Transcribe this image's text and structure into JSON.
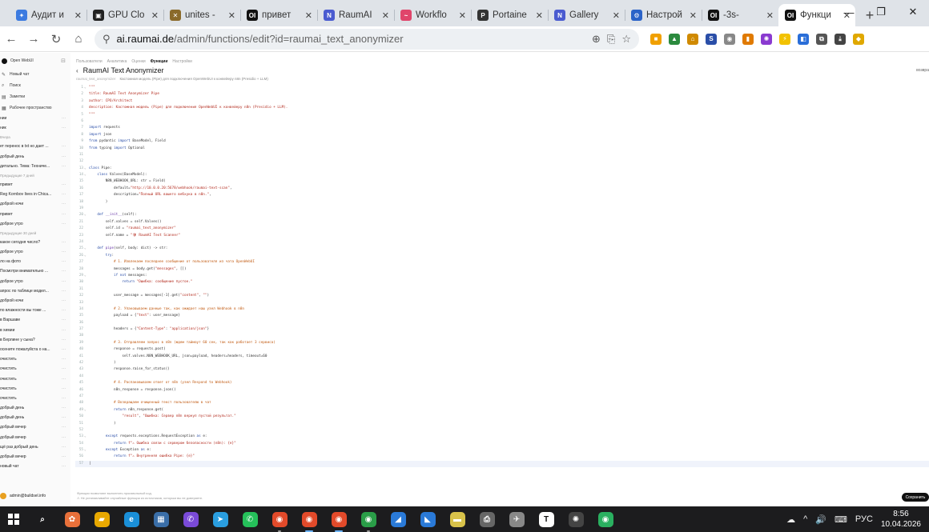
{
  "browser": {
    "tabs": [
      {
        "label": "Аудит и",
        "fav": "✦",
        "fav_color": "#3c7be0",
        "active": false
      },
      {
        "label": "GPU Clo",
        "fav": "▣",
        "fav_color": "#222222",
        "active": false
      },
      {
        "label": "unites -",
        "fav": "✕",
        "fav_color": "#8a6a2a",
        "active": false
      },
      {
        "label": "привет",
        "fav": "OI",
        "fav_color": "#111111",
        "active": false
      },
      {
        "label": "RaumAI",
        "fav": "N",
        "fav_color": "#4a5bd0",
        "active": false
      },
      {
        "label": "Workflo",
        "fav": "~",
        "fav_color": "#e0456b",
        "active": false
      },
      {
        "label": "Portaine",
        "fav": "P",
        "fav_color": "#333333",
        "active": false
      },
      {
        "label": "Gallery",
        "fav": "N",
        "fav_color": "#4a5bd0",
        "active": false
      },
      {
        "label": "Настрой",
        "fav": "⚙",
        "fav_color": "#2b63c8",
        "active": false
      },
      {
        "label": "-3s-",
        "fav": "OI",
        "fav_color": "#111111",
        "active": false
      },
      {
        "label": "Функци",
        "fav": "OI",
        "fav_color": "#111111",
        "active": true
      }
    ],
    "new_tab": "+",
    "window_controls": [
      "—",
      "❐",
      "✕"
    ],
    "url_host": "ai.raumai.de",
    "url_path": "/admin/functions/edit?id=raumai_text_anonymizer",
    "nav": {
      "back": "←",
      "forward": "→",
      "reload": "↻",
      "home": "⌂",
      "site_info": "⚲"
    },
    "omnibox_icons": [
      "⊕",
      "⎘",
      "☆"
    ],
    "extensions": [
      {
        "glyph": "■",
        "color": "#f0a000"
      },
      {
        "glyph": "▲",
        "color": "#2b8a3e"
      },
      {
        "glyph": "⌂",
        "color": "#d08a00"
      },
      {
        "glyph": "S",
        "color": "#2a4ea8"
      },
      {
        "glyph": "◉",
        "color": "#888888"
      },
      {
        "glyph": "▮",
        "color": "#e07a00"
      },
      {
        "glyph": "✺",
        "color": "#8a3ad0"
      },
      {
        "glyph": "⚡",
        "color": "#f2c200"
      },
      {
        "glyph": "◧",
        "color": "#2a6ed8"
      },
      {
        "glyph": "⧉",
        "color": "#555555"
      },
      {
        "glyph": "⤓",
        "color": "#444444"
      },
      {
        "glyph": "◆",
        "color": "#e0a800"
      }
    ]
  },
  "sidebar": {
    "app_name": "Open WebUI",
    "toggle": "⊟",
    "nav": [
      {
        "icon": "✎",
        "label": "Новый чат"
      },
      {
        "icon": "⌕",
        "label": "Поиск"
      },
      {
        "icon": "▤",
        "label": "Заметки"
      },
      {
        "icon": "▦",
        "label": "Рабочее пространство"
      }
    ],
    "sections": [
      {
        "group": "",
        "chats": [
          "нии",
          "ник"
        ]
      },
      {
        "group": "Вчера",
        "chats": [
          "ет перенос в txt но дает ...",
          "добрый день",
          "дитально. Тема: Техниче..."
        ]
      },
      {
        "group": "Предыдущие 7 дней",
        "chats": [
          "привет",
          "Reg Kornbov lives in Chica...",
          "доброй ночи",
          "привет",
          "доброе утро"
        ]
      },
      {
        "group": "Предыдущие 30 дней",
        "chats": [
          "какое сегодня число?",
          "доброе утро",
          "ло на фото",
          "Посмотри внимательно ...",
          "доброе утро",
          "апрос по таблице модел...",
          "доброй ночи",
          "по влажности вы тоже ...",
          "в Варшаве",
          "в химии",
          "в Берлине у сына?",
          "осените пожалуйста о на...",
          "очистить",
          "очистить",
          "очистить",
          "очистить"
        ]
      },
      {
        "group": "",
        "chats": [
          "очистить",
          "добрый день",
          "добрый день",
          "добрый вечер",
          "добрый вечер",
          "щё раз добрый день",
          "добрый вечер",
          "новый чат"
        ]
      }
    ],
    "user": "admin@buildsel.info"
  },
  "page": {
    "breadcrumbs": [
      "Пользователи",
      "Аналитика",
      "Оценки",
      "Функции",
      "Настройки"
    ],
    "active_breadcrumb": 3,
    "back": "‹",
    "title": "RaumAI Text Anonymizer",
    "function_id": "raumai_text_anonymizer",
    "description": "Кастомная модель (Pipe) для подключения OpenWebUI к конвейеру n8n (Presidio + LLM)",
    "right_edge": "возвра",
    "footnote_1": "Функции позволяют выполнять произвольный код.",
    "footnote_2": "⚠ Не устанавливайте случайные функции из источников, которым вы не доверяете.",
    "save_label": "Сохранить"
  },
  "editor": {
    "current_line": 57,
    "lines": [
      {
        "n": "1",
        "f": "⌄",
        "p": [
          [
            "doc",
            "\"\"\""
          ]
        ]
      },
      {
        "n": "2",
        "p": [
          [
            "doc",
            "title: RaumAI Text Anonymizer Pipe"
          ]
        ]
      },
      {
        "n": "3",
        "p": [
          [
            "doc",
            "author: CPO/Architect"
          ]
        ]
      },
      {
        "n": "4",
        "p": [
          [
            "doc",
            "description: Кастомная модель (Pipe) для подключения OpenWebUI к конвейеру n8n (Presidio + LLM)."
          ]
        ]
      },
      {
        "n": "5",
        "p": [
          [
            "doc",
            "\"\"\""
          ]
        ]
      },
      {
        "n": "6",
        "p": []
      },
      {
        "n": "7",
        "p": [
          [
            "kw",
            "import"
          ],
          [
            "t",
            " requests"
          ]
        ]
      },
      {
        "n": "8",
        "p": [
          [
            "kw",
            "import"
          ],
          [
            "t",
            " json"
          ]
        ]
      },
      {
        "n": "9",
        "p": [
          [
            "kw",
            "from"
          ],
          [
            "t",
            " pydantic "
          ],
          [
            "kw",
            "import"
          ],
          [
            "t",
            " BaseModel, Field"
          ]
        ]
      },
      {
        "n": "10",
        "p": [
          [
            "kw",
            "from"
          ],
          [
            "t",
            " typing "
          ],
          [
            "kw",
            "import"
          ],
          [
            "t",
            " Optional"
          ]
        ]
      },
      {
        "n": "11",
        "p": []
      },
      {
        "n": "12",
        "p": []
      },
      {
        "n": "13",
        "f": "⌄",
        "p": [
          [
            "kw",
            "class"
          ],
          [
            "t",
            " Pipe:"
          ]
        ]
      },
      {
        "n": "14",
        "f": "⌄",
        "p": [
          [
            "t",
            "    "
          ],
          [
            "kw",
            "class"
          ],
          [
            "t",
            " Valves(BaseModel):"
          ]
        ]
      },
      {
        "n": "15",
        "p": [
          [
            "t",
            "        N8N_WEBHOOK_URL: str = Field("
          ]
        ]
      },
      {
        "n": "16",
        "p": [
          [
            "t",
            "            default="
          ],
          [
            "str",
            "\"http://10.0.0.20:5678/webhook/raumai-text-scan\""
          ],
          [
            "t",
            ","
          ]
        ]
      },
      {
        "n": "17",
        "p": [
          [
            "t",
            "            description="
          ],
          [
            "str",
            "\"Полный URL вашего вебхука в n8n.\""
          ],
          [
            "t",
            ","
          ]
        ]
      },
      {
        "n": "18",
        "p": [
          [
            "t",
            "        )"
          ]
        ]
      },
      {
        "n": "19",
        "p": []
      },
      {
        "n": "20",
        "f": "⌄",
        "p": [
          [
            "t",
            "    "
          ],
          [
            "kw",
            "def"
          ],
          [
            "t",
            " "
          ],
          [
            "fn",
            "__init__"
          ],
          [
            "t",
            "(self):"
          ]
        ]
      },
      {
        "n": "21",
        "p": [
          [
            "t",
            "        self.valves = self.Valves()"
          ]
        ]
      },
      {
        "n": "22",
        "p": [
          [
            "t",
            "        self.id = "
          ],
          [
            "str",
            "\"raumai_text_anonymizer\""
          ]
        ]
      },
      {
        "n": "23",
        "p": [
          [
            "t",
            "        self.name = "
          ],
          [
            "str",
            "\"🛡 RaumAI Text Scanner\""
          ]
        ]
      },
      {
        "n": "24",
        "p": []
      },
      {
        "n": "25",
        "f": "⌄",
        "p": [
          [
            "t",
            "    "
          ],
          [
            "kw",
            "def"
          ],
          [
            "t",
            " "
          ],
          [
            "fn",
            "pipe"
          ],
          [
            "t",
            "(self, body: dict) -> str:"
          ]
        ]
      },
      {
        "n": "26",
        "f": "⌄",
        "p": [
          [
            "t",
            "        "
          ],
          [
            "kw",
            "try"
          ],
          [
            "t",
            ":"
          ]
        ]
      },
      {
        "n": "27",
        "p": [
          [
            "t",
            "            "
          ],
          [
            "cm",
            "# 1. Извлекаем последнее сообщение от пользователя из чата OpenWebUI"
          ]
        ]
      },
      {
        "n": "28",
        "p": [
          [
            "t",
            "            messages = body.get("
          ],
          [
            "str",
            "\"messages\""
          ],
          [
            "t",
            ", [])"
          ]
        ]
      },
      {
        "n": "29",
        "f": "⌄",
        "p": [
          [
            "t",
            "            "
          ],
          [
            "kw",
            "if not"
          ],
          [
            "t",
            " messages:"
          ]
        ]
      },
      {
        "n": "30",
        "p": [
          [
            "t",
            "                "
          ],
          [
            "kw",
            "return"
          ],
          [
            "t",
            " "
          ],
          [
            "str",
            "\"Ошибка: сообщение пустое.\""
          ]
        ]
      },
      {
        "n": "31",
        "p": []
      },
      {
        "n": "32",
        "p": [
          [
            "t",
            "            user_message = messages[-1].get("
          ],
          [
            "str",
            "\"content\""
          ],
          [
            "t",
            ", "
          ],
          [
            "str",
            "\"\""
          ],
          [
            "t",
            ")"
          ]
        ]
      },
      {
        "n": "33",
        "p": []
      },
      {
        "n": "34",
        "p": [
          [
            "t",
            "            "
          ],
          [
            "cm",
            "# 2. Упаковываем данные так, как ожидает наш узел Webhook в n8n"
          ]
        ]
      },
      {
        "n": "35",
        "p": [
          [
            "t",
            "            payload = {"
          ],
          [
            "str",
            "\"text\""
          ],
          [
            "t",
            ": user_message}"
          ]
        ]
      },
      {
        "n": "36",
        "p": []
      },
      {
        "n": "37",
        "p": [
          [
            "t",
            "            headers = {"
          ],
          [
            "str",
            "\"Content-Type\""
          ],
          [
            "t",
            ": "
          ],
          [
            "str",
            "\"application/json\""
          ],
          [
            "t",
            "}"
          ]
        ]
      },
      {
        "n": "38",
        "p": []
      },
      {
        "n": "39",
        "p": [
          [
            "t",
            "            "
          ],
          [
            "cm",
            "# 3. Отправляем запрос в n8n (ждем таймаут 60 сек, так как работает 3 сервиса)"
          ]
        ]
      },
      {
        "n": "40",
        "p": [
          [
            "t",
            "            response = requests.post("
          ]
        ]
      },
      {
        "n": "41",
        "p": [
          [
            "t",
            "                self.valves.N8N_WEBHOOK_URL, json=payload, headers=headers, timeout=60"
          ]
        ]
      },
      {
        "n": "42",
        "p": [
          [
            "t",
            "            )"
          ]
        ]
      },
      {
        "n": "43",
        "p": [
          [
            "t",
            "            response.raise_for_status()"
          ]
        ]
      },
      {
        "n": "44",
        "p": []
      },
      {
        "n": "45",
        "p": [
          [
            "t",
            "            "
          ],
          [
            "cm",
            "# 4. Распаковываем ответ от n8n (узел Respond to Webhook)"
          ]
        ]
      },
      {
        "n": "46",
        "p": [
          [
            "t",
            "            n8n_response = response.json()"
          ]
        ]
      },
      {
        "n": "47",
        "p": []
      },
      {
        "n": "48",
        "p": [
          [
            "t",
            "            "
          ],
          [
            "cm",
            "# Возвращаем очищенный текст пользователю в чат"
          ]
        ]
      },
      {
        "n": "49",
        "f": "⌄",
        "p": [
          [
            "t",
            "            "
          ],
          [
            "kw",
            "return"
          ],
          [
            "t",
            " n8n_response.get("
          ]
        ]
      },
      {
        "n": "50",
        "p": [
          [
            "t",
            "                "
          ],
          [
            "str",
            "\"result\""
          ],
          [
            "t",
            ", "
          ],
          [
            "str",
            "\"Ошибка: Сервер n8n вернул пустой результат.\""
          ]
        ]
      },
      {
        "n": "51",
        "p": [
          [
            "t",
            "            )"
          ]
        ]
      },
      {
        "n": "52",
        "p": []
      },
      {
        "n": "53",
        "f": "⌄",
        "p": [
          [
            "t",
            "        "
          ],
          [
            "kw",
            "except"
          ],
          [
            "t",
            " requests.exceptions.RequestException "
          ],
          [
            "kw",
            "as"
          ],
          [
            "t",
            " e:"
          ]
        ]
      },
      {
        "n": "54",
        "p": [
          [
            "t",
            "            "
          ],
          [
            "kw",
            "return"
          ],
          [
            "t",
            " "
          ],
          [
            "str",
            "f\"⚠ Ошибка связи с сервером безопасности (n8n): {e}\""
          ]
        ]
      },
      {
        "n": "55",
        "f": "⌄",
        "p": [
          [
            "t",
            "        "
          ],
          [
            "kw",
            "except"
          ],
          [
            "t",
            " Exception "
          ],
          [
            "kw",
            "as"
          ],
          [
            "t",
            " e:"
          ]
        ]
      },
      {
        "n": "56",
        "p": [
          [
            "t",
            "            "
          ],
          [
            "kw",
            "return"
          ],
          [
            "t",
            " "
          ],
          [
            "str",
            "f\"⚠ Внутренняя ошибка Pipe: {e}\""
          ]
        ]
      },
      {
        "n": "57",
        "p": [
          [
            "t",
            "|"
          ]
        ]
      }
    ]
  },
  "taskbar": {
    "apps": [
      {
        "glyph": "⌕",
        "color": "#1c1c1e",
        "state": ""
      },
      {
        "glyph": "✿",
        "color": "#e8703a",
        "state": ""
      },
      {
        "glyph": "▰",
        "color": "#e8a800",
        "state": ""
      },
      {
        "glyph": "e",
        "color": "#1a8fd8",
        "state": ""
      },
      {
        "glyph": "▦",
        "color": "#3a6ea8",
        "state": ""
      },
      {
        "glyph": "✆",
        "color": "#7a4ad8",
        "state": ""
      },
      {
        "glyph": "➤",
        "color": "#2a9ee0",
        "state": ""
      },
      {
        "glyph": "✆",
        "color": "#25c05a",
        "state": ""
      },
      {
        "glyph": "◉",
        "color": "#e24a2a",
        "state": "open"
      },
      {
        "glyph": "◉",
        "color": "#e24a2a",
        "state": "active"
      },
      {
        "glyph": "◉",
        "color": "#e24a2a",
        "state": "active"
      },
      {
        "glyph": "◉",
        "color": "#2a9e48",
        "state": "open"
      },
      {
        "glyph": "◢",
        "color": "#2a7ad8",
        "state": ""
      },
      {
        "glyph": "◣",
        "color": "#2a7ad8",
        "state": ""
      },
      {
        "glyph": "▬",
        "color": "#d8c24a",
        "state": ""
      },
      {
        "glyph": "⎙",
        "color": "#666666",
        "state": ""
      },
      {
        "glyph": "✈",
        "color": "#888888",
        "state": ""
      },
      {
        "glyph": "T",
        "color": "#ffffff",
        "state": ""
      },
      {
        "glyph": "✺",
        "color": "#444444",
        "state": ""
      },
      {
        "glyph": "◉",
        "color": "#2ab060",
        "state": ""
      }
    ],
    "tray_icons": [
      "☁",
      "^",
      "🔊",
      "⌨"
    ],
    "lang": "РУС",
    "time": "8:56",
    "date": "10.04.2026"
  }
}
